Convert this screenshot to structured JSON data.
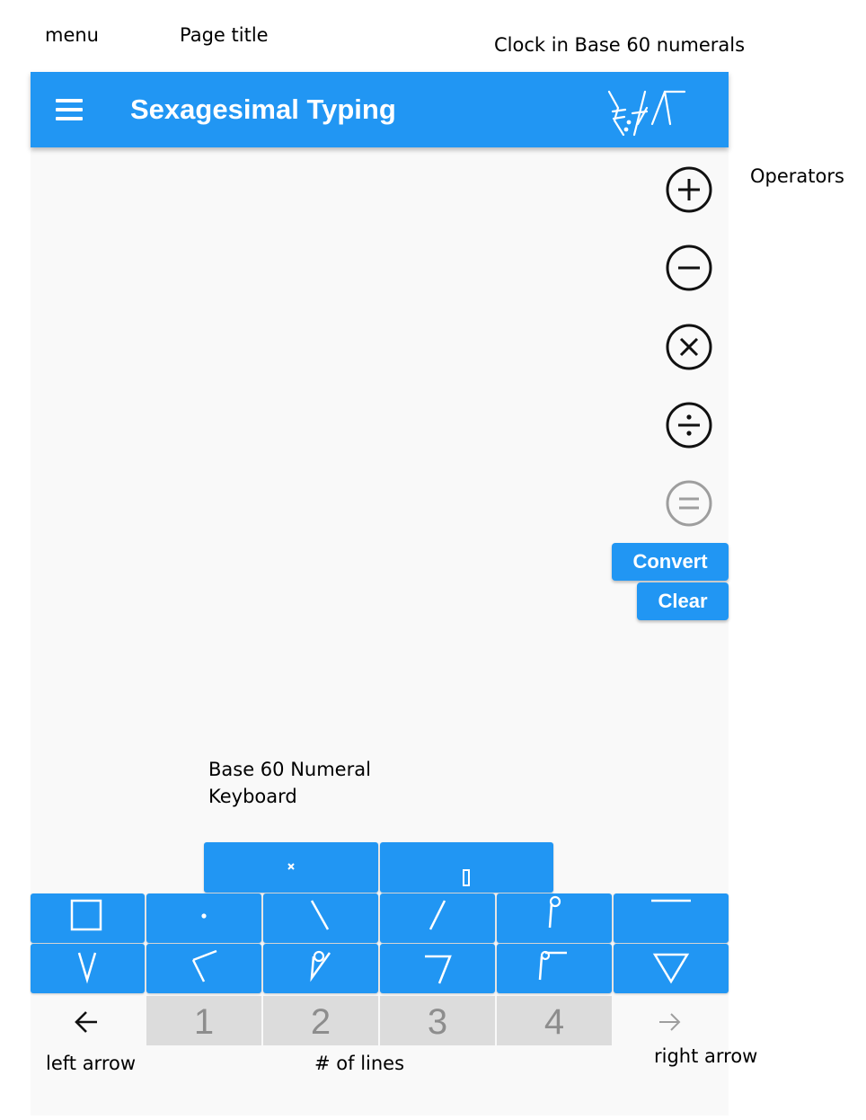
{
  "annotations": {
    "menu": "menu",
    "page_title": "Page title",
    "clock": "Clock in Base 60 numerals",
    "operators": "Operators",
    "keyboard_line1": "Base 60 Numeral",
    "keyboard_line2": "Keyboard",
    "left_arrow": "left arrow",
    "lines": "# of lines",
    "right_arrow": "right arrow"
  },
  "appbar": {
    "title": "Sexagesimal Typing",
    "menu_icon": "hamburger-menu-icon",
    "color": "#2196f3"
  },
  "operators": [
    {
      "name": "plus",
      "icon": "plus-circle-icon"
    },
    {
      "name": "minus",
      "icon": "minus-circle-icon"
    },
    {
      "name": "multiply",
      "icon": "times-circle-icon"
    },
    {
      "name": "divide",
      "icon": "divide-circle-icon"
    },
    {
      "name": "equals",
      "icon": "equals-circle-icon",
      "disabled": true
    }
  ],
  "actions": {
    "convert": "Convert",
    "clear": "Clear"
  },
  "line_count": {
    "options": [
      "1",
      "2",
      "3",
      "4"
    ]
  },
  "navigation": {
    "left_icon": "left-arrow-icon",
    "right_icon": "right-arrow-icon"
  },
  "colors": {
    "accent": "#2196f3",
    "background": "#f9f9f9",
    "line_button_bg": "#dcdcdc",
    "disabled_icon": "#9e9e9e"
  }
}
